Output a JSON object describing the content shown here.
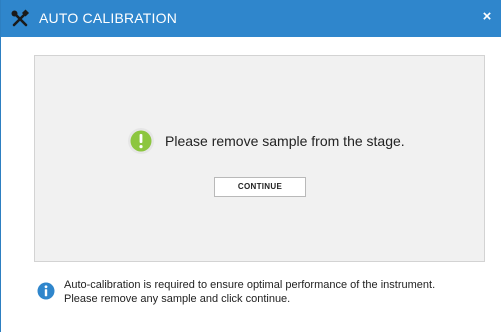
{
  "window": {
    "title": "AUTO CALIBRATION",
    "title_icon": "tools-icon",
    "close_label": "×"
  },
  "panel": {
    "status_icon": "warning-icon",
    "message": "Please remove sample from the stage.",
    "continue_label": "CONTINUE"
  },
  "info": {
    "icon": "info-icon",
    "line1": "Auto-calibration is required to ensure optimal performance of the instrument.",
    "line2": "Please remove any sample and click continue."
  },
  "colors": {
    "titlebar": "#2f86cc",
    "panel_bg": "#f1f1f1",
    "warning_green": "#8cc63f",
    "info_blue": "#2f86cc"
  }
}
